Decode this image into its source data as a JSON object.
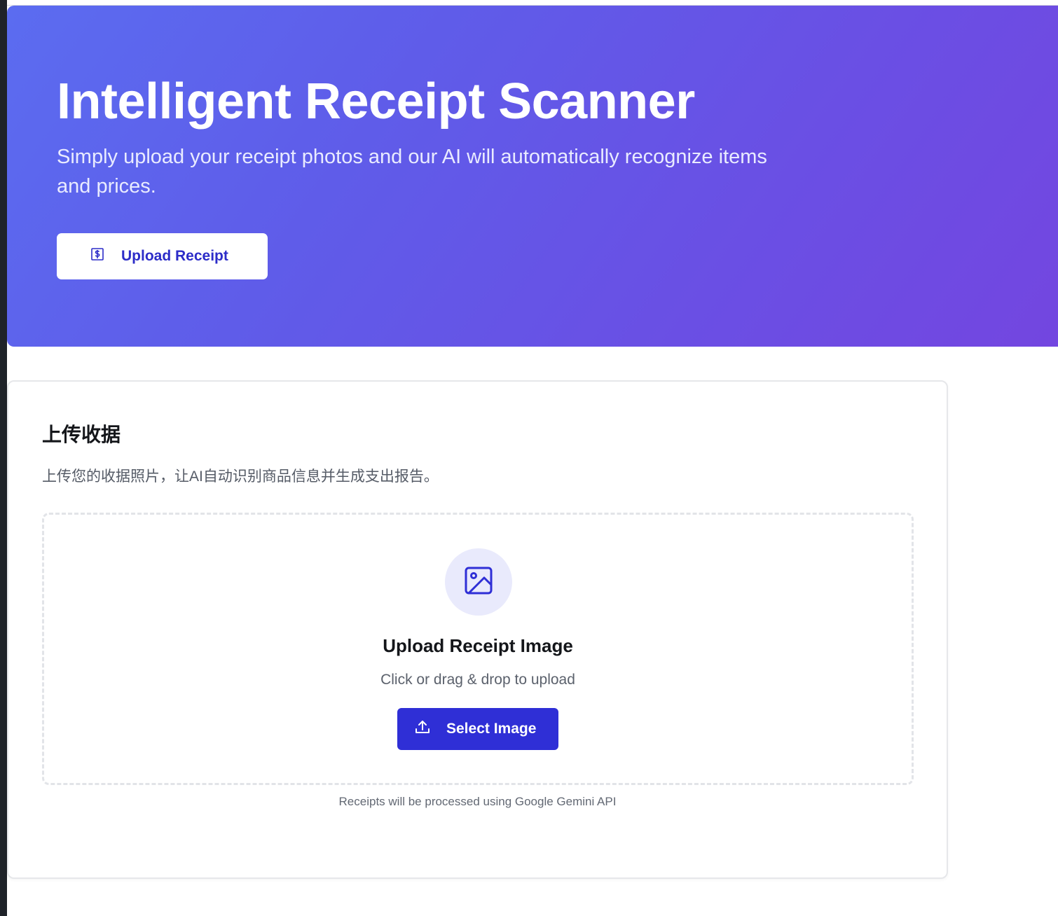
{
  "hero": {
    "title": "Intelligent Receipt Scanner",
    "subtitle": "Simply upload your receipt photos and our AI will automatically recognize items and prices.",
    "upload_button_label": "Upload Receipt",
    "upload_button_icon": "receipt-dollar-icon"
  },
  "upload_card": {
    "title": "上传收据",
    "description": "上传您的收据照片，让AI自动识别商品信息并生成支出报告。",
    "dropzone": {
      "icon": "image-icon",
      "title": "Upload Receipt Image",
      "subtitle": "Click or drag & drop to upload",
      "select_button_label": "Select Image",
      "select_button_icon": "upload-icon"
    },
    "footnote": "Receipts will be processed using Google Gemini API"
  },
  "colors": {
    "hero_gradient_start": "#5b6cf0",
    "hero_gradient_end": "#7346e0",
    "accent": "#2f2fd6",
    "icon_circle_bg": "#e9eafc"
  }
}
